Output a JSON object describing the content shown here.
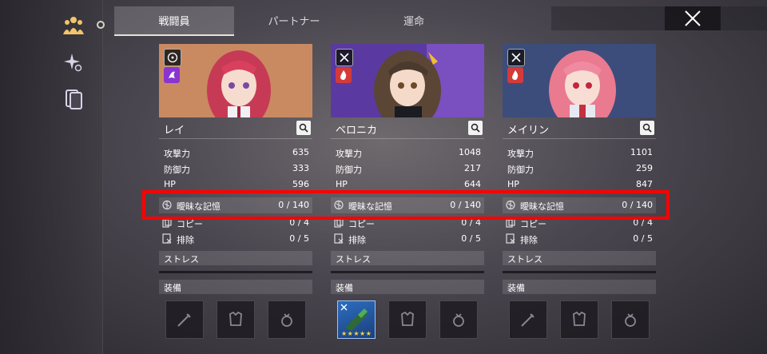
{
  "tabs": [
    {
      "label": "戦闘員"
    },
    {
      "label": "パートナー"
    },
    {
      "label": "運命"
    }
  ],
  "sidebar": {
    "items": [
      {
        "icon": "team-icon"
      },
      {
        "icon": "sparkle-icon"
      },
      {
        "icon": "cards-icon"
      }
    ]
  },
  "characters": [
    {
      "name": "レイ",
      "badges": [
        "target-class-icon",
        "purple-element-icon"
      ],
      "stats": [
        {
          "label": "攻撃力",
          "value": "635"
        },
        {
          "label": "防御力",
          "value": "333"
        },
        {
          "label": "HP",
          "value": "596"
        }
      ],
      "memory": {
        "label": "曖昧な記憶",
        "value": "0 / 140"
      },
      "copy": {
        "label": "コピー",
        "value": "0 / 4"
      },
      "exclude": {
        "label": "排除",
        "value": "0 / 5"
      },
      "stress_label": "ストレス",
      "equip_label": "装備"
    },
    {
      "name": "ベロニカ",
      "badges": [
        "crossed-swords-class-icon",
        "fire-element-icon"
      ],
      "stats": [
        {
          "label": "攻撃力",
          "value": "1048"
        },
        {
          "label": "防御力",
          "value": "217"
        },
        {
          "label": "HP",
          "value": "644"
        }
      ],
      "memory": {
        "label": "曖昧な記憶",
        "value": "0 / 140"
      },
      "copy": {
        "label": "コピー",
        "value": "0 / 4"
      },
      "exclude": {
        "label": "排除",
        "value": "0 / 5"
      },
      "stress_label": "ストレス",
      "equip_label": "装備",
      "equipped_weapon_stars": "★★★★★"
    },
    {
      "name": "メイリン",
      "badges": [
        "crossed-swords-class-icon",
        "fire-element-icon"
      ],
      "stats": [
        {
          "label": "攻撃力",
          "value": "1101"
        },
        {
          "label": "防御力",
          "value": "259"
        },
        {
          "label": "HP",
          "value": "847"
        }
      ],
      "memory": {
        "label": "曖昧な記憶",
        "value": "0 / 140"
      },
      "copy": {
        "label": "コピー",
        "value": "0 / 4"
      },
      "exclude": {
        "label": "排除",
        "value": "0 / 5"
      },
      "stress_label": "ストレス",
      "equip_label": "装備"
    }
  ],
  "colors": {
    "highlight": "#ff0000",
    "portrait_1": "#c98a62",
    "portrait_2": "#5a3aa0",
    "portrait_3": "#3c4d7c"
  }
}
